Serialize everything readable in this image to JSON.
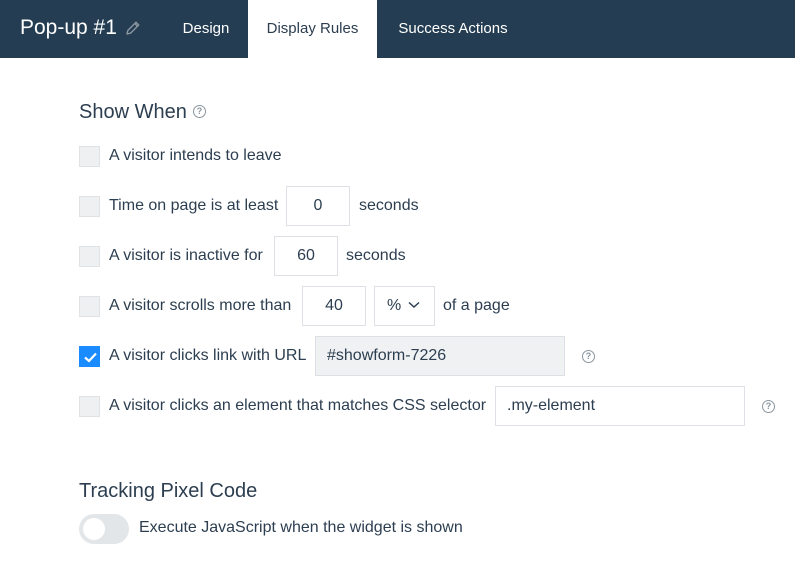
{
  "header": {
    "title": "Pop-up #1",
    "tabs": [
      {
        "label": "Design",
        "active": false
      },
      {
        "label": "Display Rules",
        "active": true
      },
      {
        "label": "Success Actions",
        "active": false
      }
    ]
  },
  "show_when": {
    "heading": "Show When",
    "rules": [
      {
        "label": "A visitor intends to leave",
        "checked": false
      },
      {
        "label": "Time on page is at least",
        "value": "0",
        "suffix": "seconds",
        "checked": false
      },
      {
        "label": "A visitor is inactive for",
        "value": "60",
        "suffix": "seconds",
        "checked": false
      },
      {
        "label": "A visitor scrolls more than",
        "value": "40",
        "unit": "%",
        "suffix": "of a page",
        "checked": false
      },
      {
        "label": "A visitor clicks link with URL",
        "value": "#showform-7226",
        "checked": true
      },
      {
        "label": "A visitor clicks an element that matches CSS selector",
        "value": ".my-element",
        "checked": false
      }
    ]
  },
  "tracking": {
    "heading": "Tracking Pixel Code",
    "toggle_label": "Execute JavaScript when the widget is shown",
    "toggle_on": false
  },
  "colors": {
    "header_bg": "#243d52",
    "accent": "#1a8cff",
    "text": "#2c3e50"
  }
}
